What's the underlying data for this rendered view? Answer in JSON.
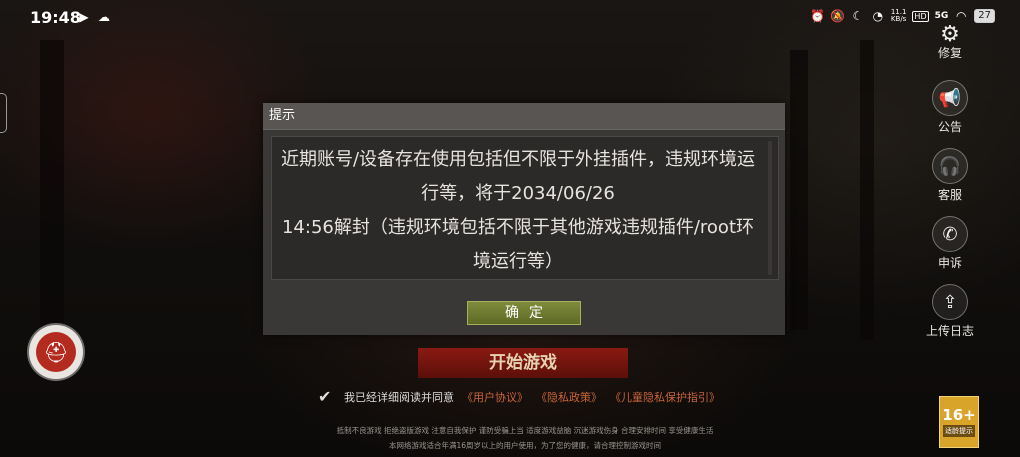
{
  "status_bar": {
    "time": "19:48",
    "network_speed_value": "11.1",
    "network_speed_unit": "KB/s",
    "hd_label": "HD",
    "cell_label": "5G",
    "battery": "27"
  },
  "side_menu": {
    "items": [
      {
        "label": "修复",
        "icon": "gear-icon"
      },
      {
        "label": "公告",
        "icon": "megaphone-icon"
      },
      {
        "label": "客服",
        "icon": "headset-icon"
      },
      {
        "label": "申诉",
        "icon": "phone-icon"
      },
      {
        "label": "上传日志",
        "icon": "upload-icon"
      }
    ]
  },
  "dialog": {
    "title": "提示",
    "message_line1": "近期账号/设备存在使用包括但不限于外挂插件，违规环境运",
    "message_line2": "行等，将于2034/06/26",
    "message_line3": "14:56解封（违规环境包括不限于其他游戏违规插件/root环",
    "message_line4": "境运行等）",
    "confirm_label": "确定"
  },
  "main": {
    "start_button_label": "开始游戏",
    "agree_prefix": "我已经详细阅读并同意",
    "agree_link_1": "《用户协议》",
    "agree_link_2": "《隐私政策》",
    "agree_link_3": "《儿童隐私保护指引》",
    "notice_line1": "抵制不良游戏 拒绝盗版游戏 注意自我保护 谨防受骗上当 适度游戏益脑 沉迷游戏伤身 合理安排时间 享受健康生活",
    "notice_line2": "本网络游戏适合年满16周岁以上的用户使用，为了您的健康，请合理控制游戏时间",
    "age_rating": "16+",
    "age_rating_sub": "适龄提示"
  },
  "colors": {
    "dialog_bg": "#3a3836",
    "dialog_header": "#585552",
    "confirm_button": "#6f7b30",
    "start_button": "#7a1610",
    "link": "#c9653a",
    "age_badge": "#d9a42a"
  }
}
